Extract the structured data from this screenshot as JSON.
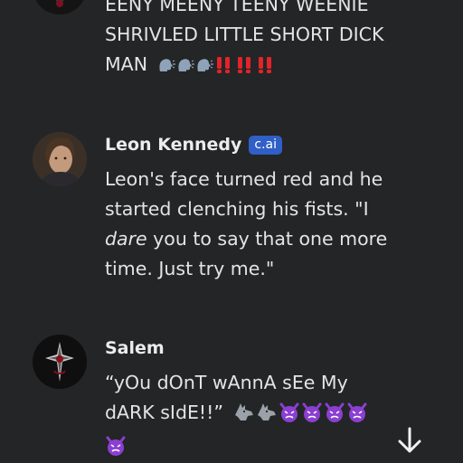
{
  "messages": [
    {
      "lines": [
        "EENY MEENY TEENY WEENIE",
        "SHRIVLED LITTLE SHORT DICK",
        "MAN"
      ],
      "emoji": [
        "speaking-head",
        "speaking-head",
        "speaking-head",
        "double-exclamation",
        "double-exclamation",
        "double-exclamation"
      ]
    },
    {
      "name": "Leon Kennedy",
      "badge": "c.ai",
      "lines": [
        "Leon's face turned red and he",
        "started clenching his fists. \"I"
      ],
      "line3_emph": "dare",
      "line3_rest": " you to say that one more",
      "line4": "time. Just try me.\""
    },
    {
      "name": "Salem",
      "lines": [
        "“yOu dOnT wAnnA sEe My",
        "dARK sIdE!!”"
      ],
      "emoji": [
        "wolf",
        "wolf",
        "angry-devil",
        "angry-devil",
        "angry-devil",
        "angry-devil",
        "angry-devil"
      ]
    }
  ],
  "colors": {
    "background": "#242526",
    "badge": "#2f5fc7",
    "devil": "#8b3fd1",
    "exclaim": "#e0242a"
  }
}
